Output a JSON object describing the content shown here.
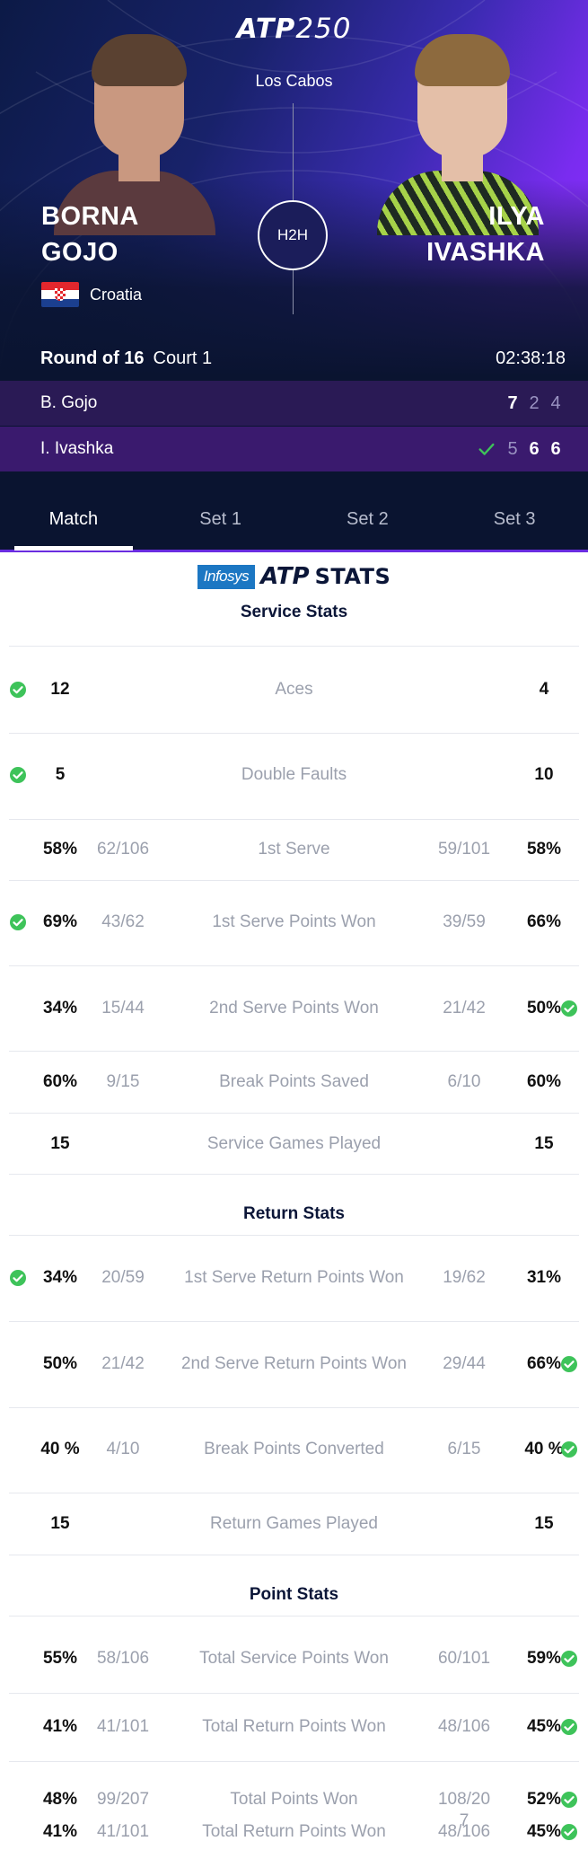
{
  "header": {
    "logo_atp": "ATP",
    "logo_num": "250",
    "location": "Los Cabos",
    "h2h_label": "H2H",
    "player1": {
      "first": "BORNA",
      "last": "GOJO",
      "country": "Croatia"
    },
    "player2": {
      "first": "ILYA",
      "last": "IVASHKA"
    },
    "round": "Round of 16",
    "court": "Court 1",
    "duration": "02:38:18",
    "colors": {
      "row1": "#2a1a55",
      "row2": "#3a1a6e",
      "accent": "#7a2cf0",
      "winner_check": "#3ec35a"
    }
  },
  "score": {
    "rows": [
      {
        "name": "B. Gojo",
        "sets": [
          "7",
          "2",
          "4"
        ],
        "won": [
          true,
          false,
          false
        ],
        "winner": false
      },
      {
        "name": "I. Ivashka",
        "sets": [
          "5",
          "6",
          "6"
        ],
        "won": [
          false,
          true,
          true
        ],
        "winner": true
      }
    ]
  },
  "tabs": [
    "Match",
    "Set 1",
    "Set 2",
    "Set 3"
  ],
  "active_tab": "Match",
  "stats_logo": {
    "sponsor": "Infosys",
    "atp": "ATP",
    "word": "STATS"
  },
  "sections": [
    {
      "title": "Service Stats",
      "rows": [
        {
          "label": "Aces",
          "left": "12",
          "left_frac": "",
          "right": "4",
          "right_frac": "",
          "left_dot": true,
          "right_dot": false
        },
        {
          "label": "Double Faults",
          "left": "5",
          "left_frac": "",
          "right": "10",
          "right_frac": "",
          "left_dot": true,
          "right_dot": false
        },
        {
          "label": "1st Serve",
          "left": "58%",
          "left_frac": "62/106",
          "right": "58%",
          "right_frac": "59/101",
          "left_dot": false,
          "right_dot": false
        },
        {
          "label": "1st Serve Points Won",
          "left": "69%",
          "left_frac": "43/62",
          "right": "66%",
          "right_frac": "39/59",
          "left_dot": true,
          "right_dot": false
        },
        {
          "label": "2nd Serve Points Won",
          "left": "34%",
          "left_frac": "15/44",
          "right": "50%",
          "right_frac": "21/42",
          "left_dot": false,
          "right_dot": true
        },
        {
          "label": "Break Points Saved",
          "left": "60%",
          "left_frac": "9/15",
          "right": "60%",
          "right_frac": "6/10",
          "left_dot": false,
          "right_dot": false
        },
        {
          "label": "Service Games Played",
          "left": "15",
          "left_frac": "",
          "right": "15",
          "right_frac": "",
          "left_dot": false,
          "right_dot": false
        }
      ]
    },
    {
      "title": "Return Stats",
      "rows": [
        {
          "label": "1st Serve Return Points Won",
          "left": "34%",
          "left_frac": "20/59",
          "right": "31%",
          "right_frac": "19/62",
          "left_dot": true,
          "right_dot": false
        },
        {
          "label": "2nd Serve Return Points Won",
          "left": "50%",
          "left_frac": "21/42",
          "right": "66%",
          "right_frac": "29/44",
          "left_dot": false,
          "right_dot": true
        },
        {
          "label": "Break Points Converted",
          "left": "40 %",
          "left_frac": "4/10",
          "right": "40 %",
          "right_frac": "6/15",
          "left_dot": false,
          "right_dot": true
        },
        {
          "label": "Return Games Played",
          "left": "15",
          "left_frac": "",
          "right": "15",
          "right_frac": "",
          "left_dot": false,
          "right_dot": false
        }
      ]
    },
    {
      "title": "Point Stats",
      "rows": [
        {
          "label": "Total Service Points Won",
          "left": "55%",
          "left_frac": "58/106",
          "right": "59%",
          "right_frac": "60/101",
          "left_dot": false,
          "right_dot": true
        },
        {
          "label": "Total Return Points Won",
          "left": "41%",
          "left_frac": "41/101",
          "right": "45%",
          "right_frac": "48/106",
          "left_dot": false,
          "right_dot": true
        },
        {
          "label": "Total Points Won",
          "left": "48%",
          "left_frac": "99/207",
          "right": "52%",
          "right_frac": "108/20\n7",
          "left_dot": false,
          "right_dot": true
        },
        {
          "label": "Total Return Points Won",
          "left": "41%",
          "left_frac": "41/101",
          "right": "45%",
          "right_frac": "48/106",
          "left_dot": false,
          "right_dot": true
        }
      ]
    }
  ]
}
